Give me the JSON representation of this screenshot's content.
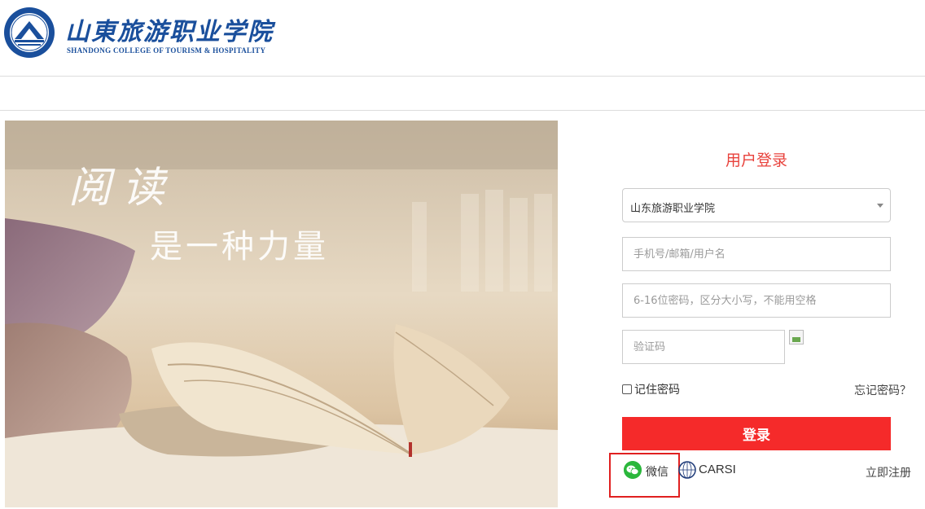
{
  "header": {
    "logo_cn": "山東旅游职业学院",
    "logo_en": "SHANDONG COLLEGE OF TOURISM & HOSPITALITY"
  },
  "banner": {
    "line1": "阅读",
    "line2": "是一种力量"
  },
  "login": {
    "title": "用户登录",
    "school_select": "山东旅游职业学院",
    "username_placeholder": "手机号/邮箱/用户名",
    "password_placeholder": "6-16位密码，区分大小写，不能用空格",
    "captcha_placeholder": "验证码",
    "remember_label": "记住密码",
    "forgot_label": "忘记密码？",
    "submit_label": "登录",
    "wechat_label": "微信",
    "carsi_label": "CARSI",
    "register_label": "立即注册"
  },
  "colors": {
    "brand_blue": "#1a4f9c",
    "accent_red": "#e8423c",
    "button_red": "#f52a2a",
    "wechat_green": "#2bb73c"
  },
  "icons": {
    "school_logo": "school-seal-icon",
    "wechat": "wechat-icon",
    "carsi": "carsi-icon",
    "select_caret": "chevron-down-icon",
    "captcha": "broken-image-icon"
  }
}
